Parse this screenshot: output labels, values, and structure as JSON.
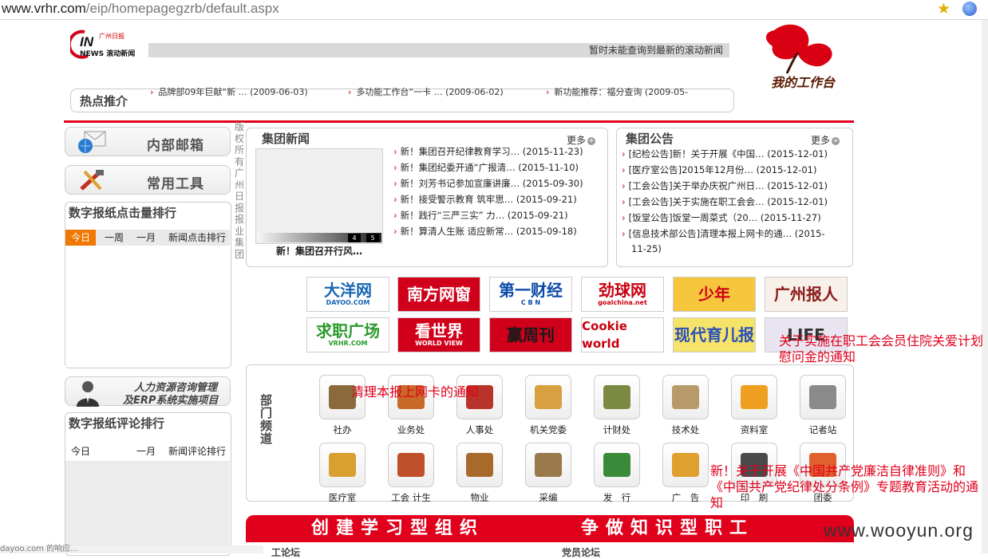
{
  "browser": {
    "url_domain": "www.vrhr.com",
    "url_path": "/eip/homepagegzrb/default.aspx"
  },
  "header": {
    "logo_small_text": "广州日报",
    "logo_sub_text": "NEWS 滚动新闻",
    "ticker_text": "暂时未能查询到最新的滚动新闻",
    "workbench_label": "我的工作台"
  },
  "hot": {
    "label": "热点推介",
    "items": [
      "品牌部09年巨献“新 … (2009-06-03)",
      "多功能工作台“一卡 … (2009-06-02)",
      "新功能推荐：福分查询 (2009-05-"
    ]
  },
  "sidebar": {
    "mail_label": "内部邮箱",
    "tools_label": "常用工具",
    "click_rank_title": "数字报纸点击量排行",
    "click_rank_tabs": [
      "今日",
      "一周",
      "一月",
      "新闻点击排行"
    ],
    "hr_line1": "人力资源咨询管理",
    "hr_line2": "及ERP系统实施项目",
    "comment_rank_title": "数字报纸评论排行",
    "comment_rank_tabs": [
      "今日",
      "一月",
      "新闻评论排行"
    ]
  },
  "copyright_vertical": "版权所有广州日报报业集团",
  "group_news": {
    "title": "集团新闻",
    "more": "更多",
    "pages": [
      "4",
      "5"
    ],
    "image_caption": "新！集团召开行风…",
    "items": [
      "新！集团召开纪律教育学习… (2015-11-23)",
      "新！集团纪委开通“广报清… (2015-11-10)",
      "新！刘芳书记参加宣廉讲廉… (2015-09-30)",
      "新！接受警示教育 筑牢思… (2015-09-21)",
      "新！践行“三严三实” 力… (2015-09-21)",
      "新！算清人生账 适应新常… (2015-09-18)"
    ]
  },
  "group_notice": {
    "title": "集团公告",
    "more": "更多",
    "items": [
      "[纪检公告]新！关于开展《中国… (2015-12-01)",
      "[医疗室公告]2015年12月份… (2015-12-01)",
      "[工会公告]关于举办庆祝广州日… (2015-12-01)",
      "[工会公告]关于实施在职工会会… (2015-12-01)",
      "[饭堂公告]饭堂一周菜式（20… (2015-11-27)",
      "[信息技术部公告]清理本报上网卡的通… (2015-",
      "11-25)"
    ]
  },
  "partner_logos": [
    {
      "text": "大洋网",
      "sub": "DAYOO.COM",
      "fg": "#1a66b3",
      "bg": "#ffffff"
    },
    {
      "text": "南方网窗",
      "sub": "",
      "fg": "#ffffff",
      "bg": "#d0001a"
    },
    {
      "text": "第一财经",
      "sub": "C B N",
      "fg": "#0b4aa8",
      "bg": "#ffffff"
    },
    {
      "text": "劲球网",
      "sub": "goalchina.net",
      "fg": "#c8000e",
      "bg": "#ffffff"
    },
    {
      "text": "少年",
      "sub": "",
      "fg": "#d0001a",
      "bg": "#f6c63c"
    },
    {
      "text": "广州报人",
      "sub": "",
      "fg": "#8b1a1a",
      "bg": "#f7f1ea"
    },
    {
      "text": "求职广场",
      "sub": "VRHR.COM",
      "fg": "#2a9a2a",
      "bg": "#ffffff"
    },
    {
      "text": "看世界",
      "sub": "WORLD VIEW",
      "fg": "#ffffff",
      "bg": "#d0001a"
    },
    {
      "text": "赢周刊",
      "sub": "",
      "fg": "#1a1a1a",
      "bg": "#d0001a"
    },
    {
      "text": "Cookie world",
      "sub": "",
      "fg": "#c8000e",
      "bg": "#ffffff"
    },
    {
      "text": "现代育儿报",
      "sub": "",
      "fg": "#2a4fb8",
      "bg": "#f5e36a"
    },
    {
      "text": "LIFE",
      "sub": "",
      "fg": "#333333",
      "bg": "#e8e4f0"
    }
  ],
  "departments": {
    "label": "部门频道",
    "row1": [
      "社办",
      "业务处",
      "人事处",
      "机关党委",
      "计财处",
      "技术处",
      "资料室",
      "记者站"
    ],
    "row2": [
      "医疗室",
      "工会 计生",
      "物业",
      "采编",
      "发　行",
      "广　告",
      "印　刷",
      "团委"
    ],
    "colors": [
      "#8a6a3a",
      "#c8692a",
      "#b8342a",
      "#d8a040",
      "#7a8a40",
      "#b89a6a",
      "#f0a020",
      "#8a8a8a",
      "#d8a030",
      "#c0502a",
      "#a86a2a",
      "#9a7a4a",
      "#3a8a3a",
      "#e0a030",
      "#4a4a4a",
      "#e06030"
    ]
  },
  "banner": {
    "left": "创建学习型组织",
    "right": "争做知识型职工"
  },
  "overlays": {
    "a": "关于实施在职工会会员住院关爱计划慰问金的通知",
    "b": "清理本报上网卡的通知",
    "c": "新！关于开展《中国共产党廉洁自律准则》和《中国共产党纪律处分条例》专题教育活动的通知"
  },
  "watermark": "www.wooyun.org",
  "status_text": "dayoo.com 的响应…",
  "sub_left": "工论坛",
  "sub_right": "党员论坛"
}
